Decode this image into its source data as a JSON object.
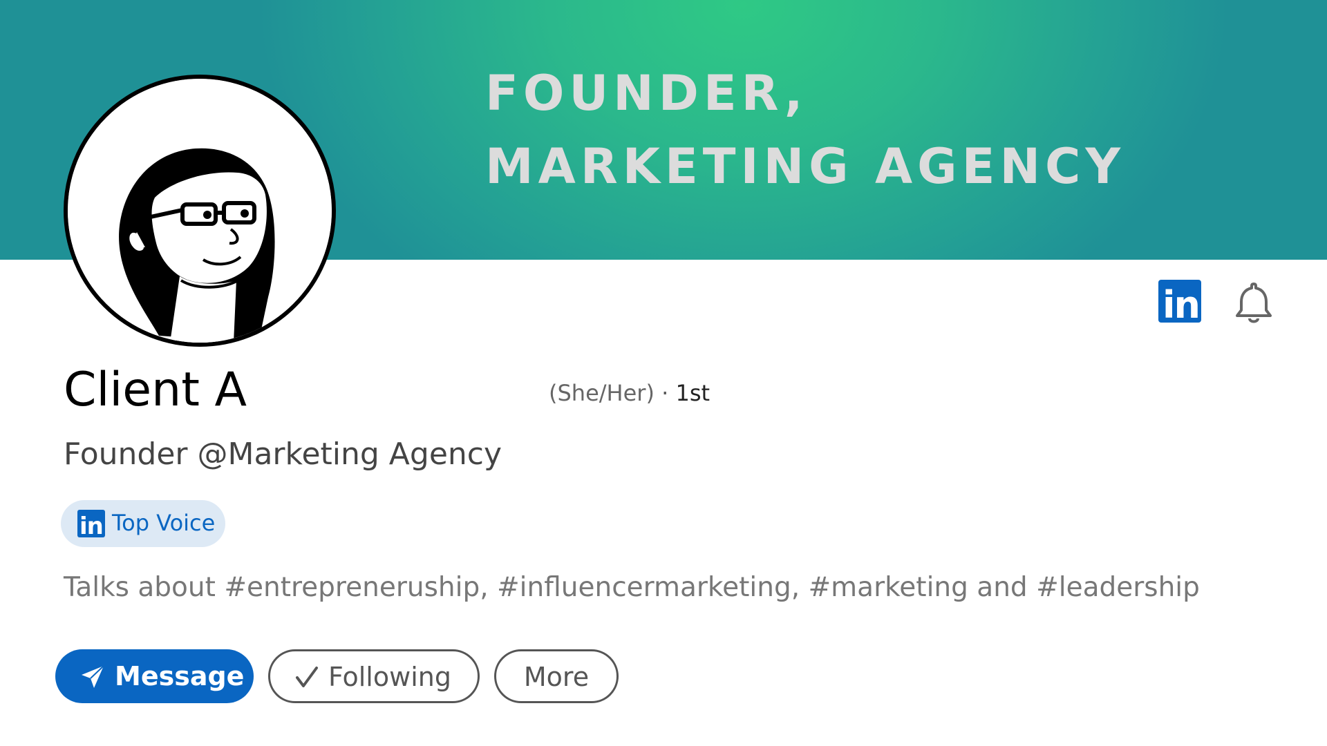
{
  "banner": {
    "line1": "FOUNDER,",
    "line2": "MARKETING AGENCY",
    "colors": {
      "gradient_center": "#2fc985",
      "gradient_edge": "#1f9196",
      "text": "#dcdcdc"
    }
  },
  "profile": {
    "avatar_icon": "cartoon-woman-avatar",
    "name": "Client A",
    "pronouns": "(She/Her)",
    "separator": "·",
    "connection_degree": "1st",
    "headline": "Founder @Marketing Agency",
    "badge": {
      "icon": "linkedin-icon",
      "logo_text": "in",
      "label": "Top Voice"
    },
    "about": "Talks about #entrepreneruship, #influencermarketing, #marketing and #leadership"
  },
  "top_icons": {
    "linkedin_logo_text": "in",
    "linkedin_icon": "linkedin-icon",
    "bell_icon": "bell-icon"
  },
  "actions": {
    "message": {
      "label": "Message",
      "icon": "send-icon"
    },
    "following": {
      "label": "Following",
      "icon": "check-icon"
    },
    "more": {
      "label": "More"
    }
  },
  "colors": {
    "linkedin_blue": "#0a66c2",
    "badge_bg": "#dde9f5",
    "outline_gray": "#555555"
  }
}
